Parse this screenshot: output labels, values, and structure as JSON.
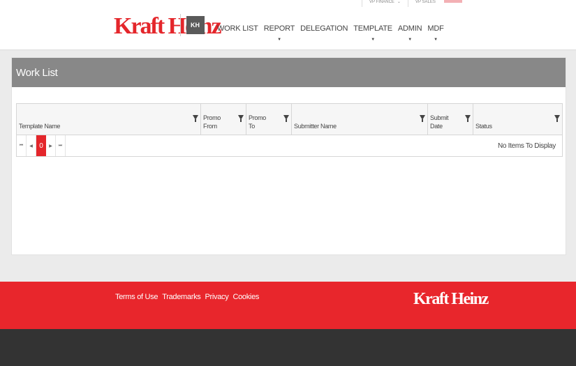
{
  "header": {
    "logo_text": "Kraft Heinz",
    "badge_text": "KH",
    "topbar": {
      "user_label": "VP FINANCE",
      "other_label": "VP SALES"
    },
    "nav": [
      {
        "label": "WORK LIST",
        "has_dropdown": false
      },
      {
        "label": "REPORT",
        "has_dropdown": true
      },
      {
        "label": "DELEGATION",
        "has_dropdown": false
      },
      {
        "label": "TEMPLATE",
        "has_dropdown": true
      },
      {
        "label": "ADMIN",
        "has_dropdown": true
      },
      {
        "label": "MDF",
        "has_dropdown": true
      }
    ],
    "caret_glyph": "▼"
  },
  "page": {
    "title": "Work List"
  },
  "grid": {
    "columns": [
      {
        "line1": "Template Name",
        "line2": ""
      },
      {
        "line1": "Promo",
        "line2": "From"
      },
      {
        "line1": "Promo",
        "line2": "To"
      },
      {
        "line1": "Submitter Name",
        "line2": ""
      },
      {
        "line1": "Submit",
        "line2": "Date"
      },
      {
        "line1": "Status",
        "line2": ""
      }
    ],
    "pager": {
      "first": "⏮",
      "prev": "◀",
      "current_page": "0",
      "next": "▶",
      "last": "⏭",
      "empty_message": "No Items To Display"
    }
  },
  "footer": {
    "links": [
      "Terms of Use",
      "Trademarks",
      "Privacy",
      "Cookies"
    ],
    "logo_text": "Kraft Heinz"
  },
  "colors": {
    "accent": "#e4262b",
    "title_bar": "#888888",
    "bottom_bar": "#333333"
  }
}
